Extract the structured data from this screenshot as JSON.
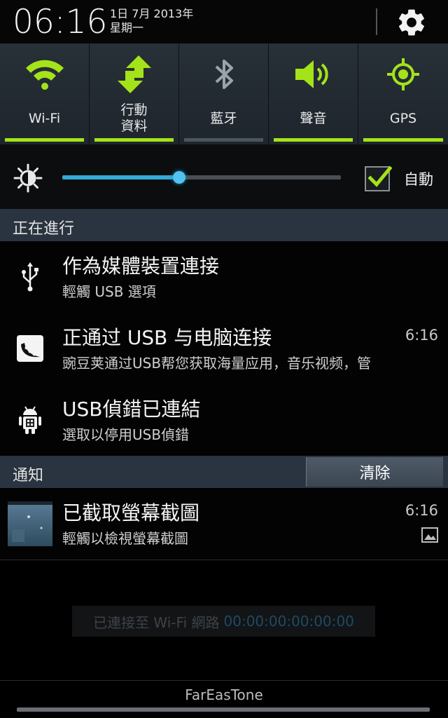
{
  "status": {
    "time": "06:16",
    "date": "1日 7月 2013年",
    "weekday": "星期一"
  },
  "toggles": [
    {
      "label": "Wi-Fi",
      "icon": "wifi-icon",
      "on": true
    },
    {
      "label": "行動\n資料",
      "icon": "mobile-data-icon",
      "on": true
    },
    {
      "label": "藍牙",
      "icon": "bluetooth-icon",
      "on": false
    },
    {
      "label": "聲音",
      "icon": "sound-icon",
      "on": true
    },
    {
      "label": "GPS",
      "icon": "gps-icon",
      "on": true
    }
  ],
  "brightness": {
    "level": 0.42,
    "auto_label": "自動",
    "auto_checked": true
  },
  "ongoing": {
    "title": "正在進行",
    "items": [
      {
        "title": "作為媒體裝置連接",
        "subtitle": "輕觸 USB 選項",
        "time": "",
        "icon": "usb-icon"
      },
      {
        "title": "正通过 USB 与电脑连接",
        "subtitle": "豌豆荚通过USB帮您获取海量应用，音乐视频，管",
        "time": "6:16",
        "icon": "wandoujia-icon"
      },
      {
        "title": "USB偵錯已連結",
        "subtitle": "選取以停用USB偵錯",
        "time": "",
        "icon": "android-debug-icon"
      }
    ]
  },
  "notifications": {
    "title": "通知",
    "clear_label": "清除",
    "items": [
      {
        "title": "已截取螢幕截圖",
        "subtitle": "輕觸以檢視螢幕截圖",
        "time": "6:16",
        "icon": "screenshot-thumbnail",
        "badge_icon": "image-icon"
      }
    ]
  },
  "wifi_banner": {
    "text": "已連接至 Wi-Fi 網路",
    "mac": "00:00:00:00:00:00"
  },
  "carrier": "FarEasTone",
  "colors": {
    "accent_green": "#a4e31a",
    "slider_blue": "#35a8d8",
    "section_bg": "#2a3440"
  }
}
